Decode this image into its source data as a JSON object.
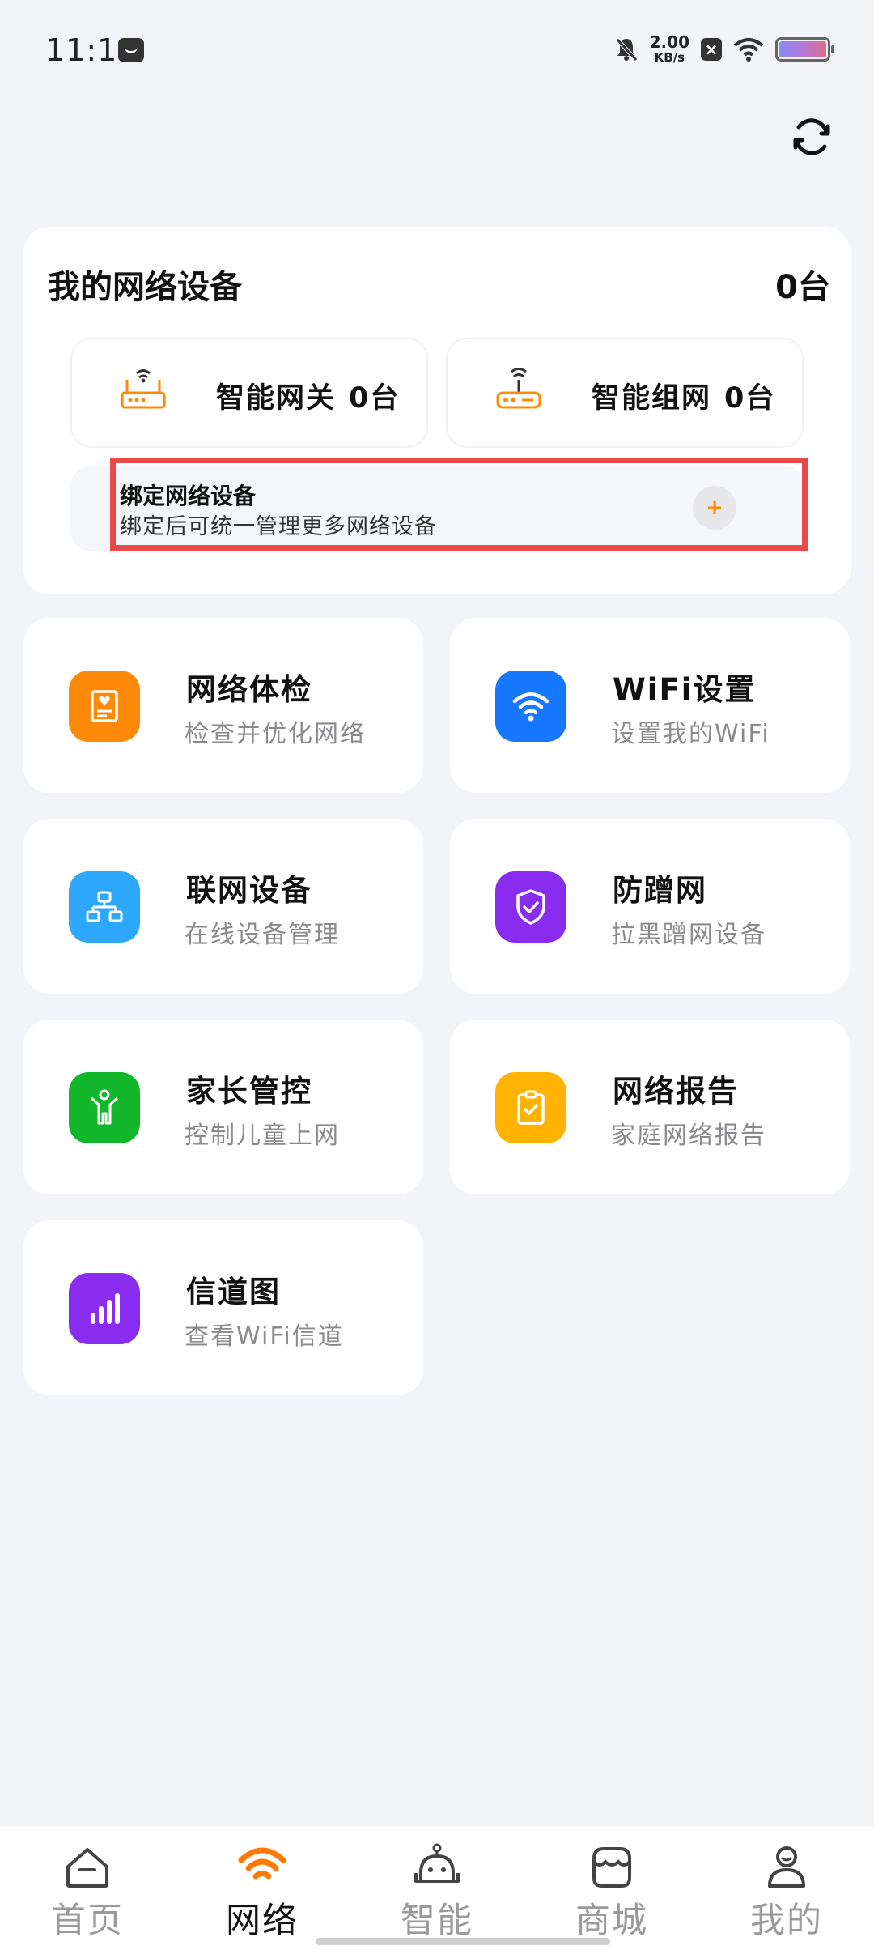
{
  "status_bar": {
    "time": "11:11",
    "net_speed_value": "2.00",
    "net_speed_unit": "KB/s",
    "x_badge": "×"
  },
  "network_devices": {
    "title": "我的网络设备",
    "total": "0台",
    "gateway": {
      "label": "智能网关",
      "count": "0台"
    },
    "mesh": {
      "label": "智能组网",
      "count": "0台"
    },
    "bind": {
      "title": "绑定网络设备",
      "description": "绑定后可统一管理更多网络设备",
      "add_symbol": "+"
    }
  },
  "features": [
    {
      "title": "网络体检",
      "subtitle": "检查并优化网络",
      "icon": "health-check-icon",
      "color": "#ff8a0a"
    },
    {
      "title": "WiFi设置",
      "subtitle": "设置我的WiFi",
      "icon": "wifi-icon",
      "color": "#1677ff"
    },
    {
      "title": "联网设备",
      "subtitle": "在线设备管理",
      "icon": "topology-icon",
      "color": "#2ea8ff"
    },
    {
      "title": "防蹭网",
      "subtitle": "拉黑蹭网设备",
      "icon": "shield-icon",
      "color": "#8a2bf0"
    },
    {
      "title": "家长管控",
      "subtitle": "控制儿童上网",
      "icon": "child-icon",
      "color": "#12b62a"
    },
    {
      "title": "网络报告",
      "subtitle": "家庭网络报告",
      "icon": "report-icon",
      "color": "#ffb300"
    },
    {
      "title": "信道图",
      "subtitle": "查看WiFi信道",
      "icon": "channel-chart-icon",
      "color": "#8a2bf0"
    }
  ],
  "bottom_nav": {
    "active": "网络",
    "items": [
      {
        "label": "首页",
        "icon": "home-icon"
      },
      {
        "label": "网络",
        "icon": "wifi-icon"
      },
      {
        "label": "智能",
        "icon": "robot-icon"
      },
      {
        "label": "商城",
        "icon": "store-icon"
      },
      {
        "label": "我的",
        "icon": "person-icon"
      }
    ]
  },
  "colors": {
    "accent": "#ff7a00",
    "background": "#f3f4f8",
    "highlight": "#e84a4a"
  }
}
